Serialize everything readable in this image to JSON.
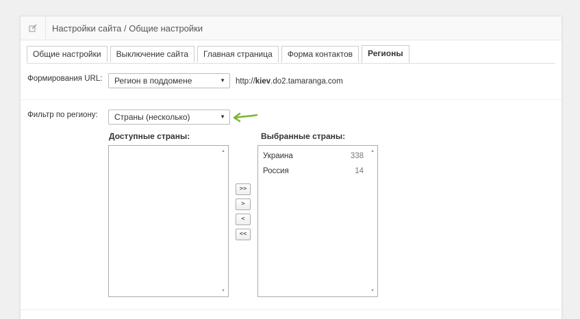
{
  "header": {
    "title": "Настройки сайта / Общие настройки",
    "icon": "edit-icon"
  },
  "tabs": [
    {
      "label": "Общие настройки",
      "active": false
    },
    {
      "label": "Выключение сайта",
      "active": false
    },
    {
      "label": "Главная страница",
      "active": false
    },
    {
      "label": "Форма контактов",
      "active": false
    },
    {
      "label": "Регионы",
      "active": true
    }
  ],
  "url_setting": {
    "label": "Формирования URL:",
    "selected": "Регион в поддомене",
    "example_prefix": "http://",
    "example_bold": "kiev",
    "example_suffix": ".do2.tamaranga.com"
  },
  "filter": {
    "label": "Фильтр по региону:",
    "selected": "Страны (несколько)",
    "arrow_color": "#7ab52e"
  },
  "available": {
    "title": "Доступные страны:",
    "items": []
  },
  "selected_list": {
    "title": "Выбранные страны:",
    "items": [
      {
        "name": "Украина",
        "count": "338"
      },
      {
        "name": "Россия",
        "count": "14"
      }
    ]
  },
  "move_buttons": {
    "all_right": ">>",
    "right": ">",
    "left": "<",
    "all_left": "<<"
  },
  "caret": "▼",
  "scroll_up": "▲",
  "scroll_down": "▼"
}
